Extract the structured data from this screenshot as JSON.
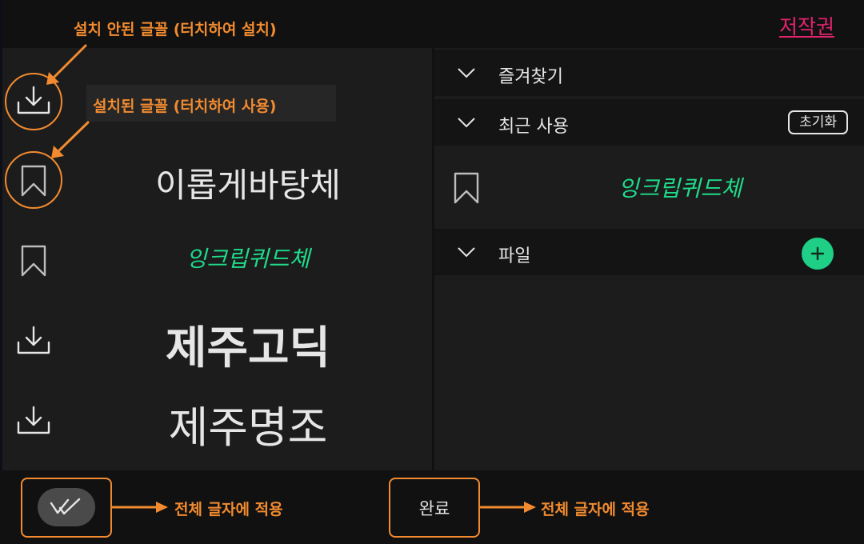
{
  "header": {
    "copyright_link": "저작권"
  },
  "font_list": [
    {
      "name": "이롭게바탕체",
      "state": "bookmark",
      "icon": "bookmark-icon",
      "color": "#e6e6e6"
    },
    {
      "name": "잉크립퀴드체",
      "state": "bookmark",
      "icon": "bookmark-icon",
      "color": "#1fdc8a"
    },
    {
      "name": "제주고딕",
      "state": "download",
      "icon": "download-icon",
      "color": "#e6e6e6"
    },
    {
      "name": "제주명조",
      "state": "download",
      "icon": "download-icon",
      "color": "#e6e6e6"
    }
  ],
  "sidebar": {
    "favorites": {
      "label": "즐겨찾기",
      "icon": "chevron-down-icon"
    },
    "recent": {
      "label": "최근 사용",
      "reset_label": "초기화",
      "items": [
        {
          "name": "잉크립퀴드체",
          "icon": "bookmark-icon",
          "color": "#1fdc8a"
        }
      ]
    },
    "files": {
      "label": "파일",
      "add_icon": "plus-icon"
    }
  },
  "bottom": {
    "apply_all_toggle_icon": "double-check-icon",
    "done_label": "완료"
  },
  "annotations": {
    "not_installed": "설치 안된 글꼴 (터치하여 설치)",
    "installed": "설치된 글꼴 (터치하여 사용)",
    "apply_all_1": "전체 글자에 적용",
    "apply_all_2": "전체 글자에 적용"
  },
  "colors": {
    "accent_green": "#1fcf86",
    "annotation_orange": "#f28b30",
    "copyright_pink": "#e0246e"
  }
}
